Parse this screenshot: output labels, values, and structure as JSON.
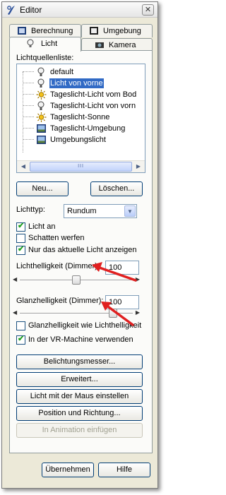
{
  "window": {
    "title": "Editor"
  },
  "tabs": {
    "berechnung": "Berechnung",
    "umgebung": "Umgebung",
    "licht": "Licht",
    "kamera": "Kamera"
  },
  "lights": {
    "label": "Lichtquellenliste:",
    "items": [
      {
        "name": "default",
        "icon": "bulb-icon",
        "selected": false
      },
      {
        "name": "Licht von vorne",
        "icon": "bulb-icon",
        "selected": true
      },
      {
        "name": "Tageslicht-Licht vom Bod",
        "icon": "sun-icon",
        "selected": false
      },
      {
        "name": "Tageslicht-Licht von vorn",
        "icon": "bulb-icon",
        "selected": false
      },
      {
        "name": "Tageslicht-Sonne",
        "icon": "sun-icon",
        "selected": false
      },
      {
        "name": "Tageslicht-Umgebung",
        "icon": "environment-icon",
        "selected": false
      },
      {
        "name": "Umgebungslicht",
        "icon": "environment-icon",
        "selected": false
      }
    ]
  },
  "buttons": {
    "neu": "Neu...",
    "loeschen": "Löschen...",
    "belichtungsmesser": "Belichtungsmesser...",
    "erweitert": "Erweitert...",
    "maus": "Licht mit der Maus einstellen",
    "position": "Position und Richtung...",
    "animation": "In Animation einfügen",
    "uebernehmen": "Übernehmen",
    "hilfe": "Hilfe"
  },
  "lichttyp": {
    "label": "Lichttyp:",
    "value": "Rundum"
  },
  "checkboxes": {
    "licht_an": {
      "label": "Licht an",
      "checked": true
    },
    "schatten": {
      "label": "Schatten werfen",
      "checked": false
    },
    "nur_aktuelle": {
      "label": "Nur das aktuelle Licht anzeigen",
      "checked": true
    },
    "glanz_wie": {
      "label": "Glanzhelligkeit wie Lichthelligkeit",
      "checked": false
    },
    "vr": {
      "label": "In der VR-Machine verwenden",
      "checked": true
    }
  },
  "lichthelligkeit": {
    "label": "Lichthelligkeit (Dimmer):",
    "value": "100",
    "level": 0.5
  },
  "glanzhelligkeit": {
    "label": "Glanzhelligkeit (Dimmer):",
    "value": "100",
    "level": 0.85
  },
  "colors": {
    "annotation": "#e02020",
    "selection": "#316ac5",
    "check": "#21a121"
  }
}
